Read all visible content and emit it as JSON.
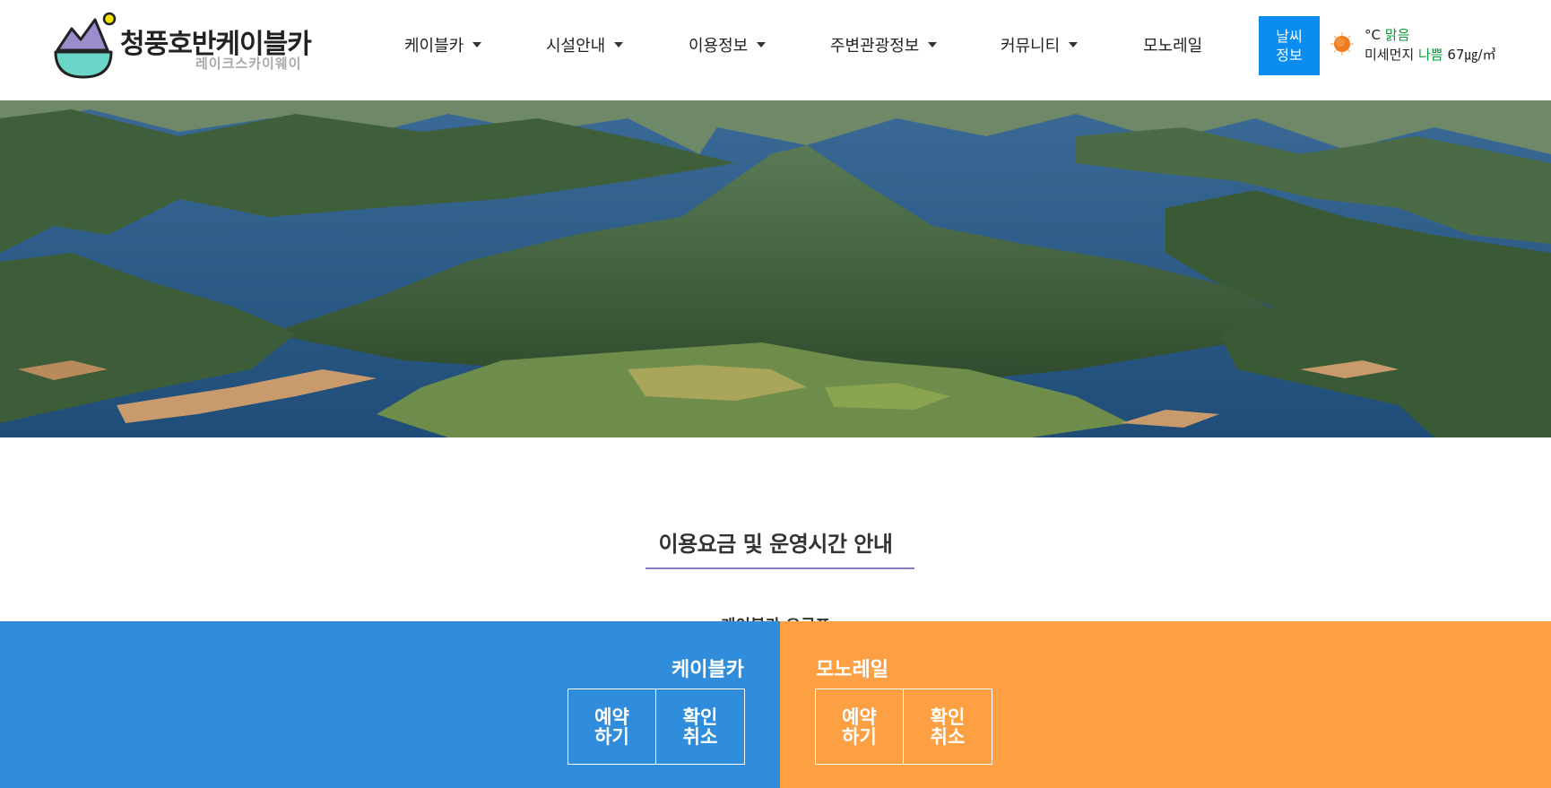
{
  "brand": {
    "title": "청풍호반케이블카",
    "subtitle": "레이크스카이웨이"
  },
  "nav": {
    "items": [
      {
        "label": "케이블카",
        "has_dropdown": true
      },
      {
        "label": "시설안내",
        "has_dropdown": true
      },
      {
        "label": "이용정보",
        "has_dropdown": true
      },
      {
        "label": "주변관광정보",
        "has_dropdown": true
      },
      {
        "label": "커뮤니티",
        "has_dropdown": true
      },
      {
        "label": "모노레일",
        "has_dropdown": false
      }
    ]
  },
  "weather": {
    "button_line1": "날씨",
    "button_line2": "정보",
    "temp_unit": "°C",
    "condition": "맑음",
    "dust_label": "미세먼지",
    "dust_status": "나쁨",
    "dust_value": "67㎍/㎥",
    "icon": "sun-icon"
  },
  "content": {
    "section_title": "이용요금 및 운영시간 안내",
    "subsection_title": "케이블카 요금표"
  },
  "quick_bar": {
    "cablecar": {
      "title": "케이블카",
      "reserve_label": "예약\n하기",
      "check_label": "확인\n취소"
    },
    "monorail": {
      "title": "모노레일",
      "reserve_label": "예약\n하기",
      "check_label": "확인\n취소"
    }
  },
  "colors": {
    "accent_blue": "#0a8cf0",
    "cablecar_bar": "#2f8ddb",
    "monorail_bar": "#fda043",
    "title_underline": "#8b7bc6",
    "good_green": "#0a9a3a"
  }
}
